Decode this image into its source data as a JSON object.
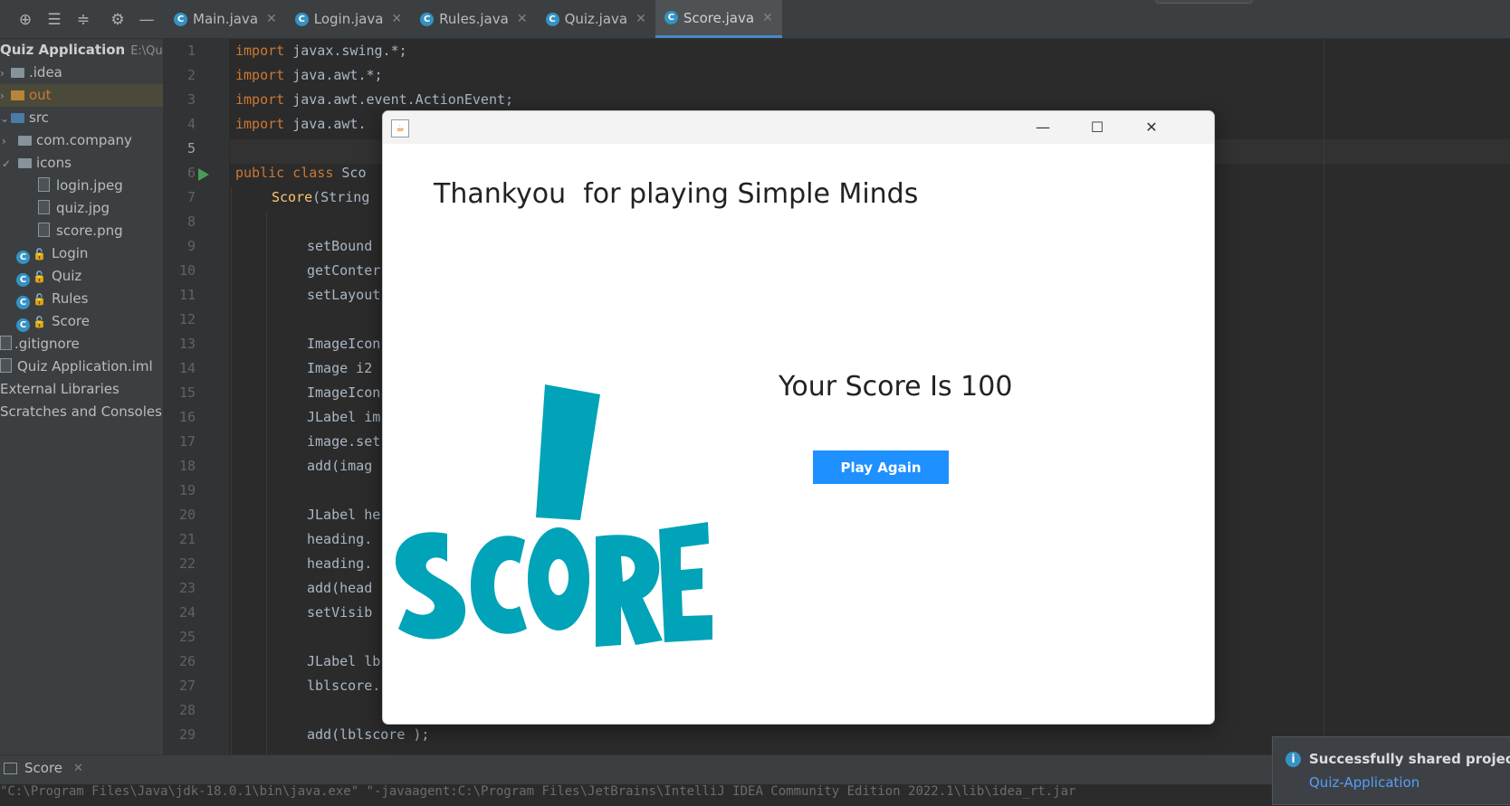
{
  "toolbar": {
    "icons": [
      "crosshair-icon",
      "expand-all-icon",
      "collapse-all-icon",
      "gear-icon",
      "minimize-icon"
    ]
  },
  "tabs": [
    {
      "label": "Main.java",
      "active": false
    },
    {
      "label": "Login.java",
      "active": false
    },
    {
      "label": "Rules.java",
      "active": false
    },
    {
      "label": "Quiz.java",
      "active": false
    },
    {
      "label": "Score.java",
      "active": true
    }
  ],
  "project": {
    "root_name": "Quiz Application",
    "root_path": "E:\\Quiz Ap",
    "items": [
      {
        "label": ".idea"
      },
      {
        "label": "out"
      },
      {
        "label": "src"
      },
      {
        "label": "com.company"
      },
      {
        "label": "icons"
      },
      {
        "label": "login.jpeg"
      },
      {
        "label": "quiz.jpg"
      },
      {
        "label": "score.png"
      },
      {
        "label": "Login"
      },
      {
        "label": "Quiz"
      },
      {
        "label": "Rules"
      },
      {
        "label": "Score"
      },
      {
        "label": ".gitignore"
      },
      {
        "label": "Quiz Application.iml"
      },
      {
        "label": "External Libraries"
      },
      {
        "label": "Scratches and Consoles"
      }
    ]
  },
  "editor": {
    "line_numbers": [
      "1",
      "2",
      "3",
      "4",
      "5",
      "6",
      "7",
      "8",
      "9",
      "10",
      "11",
      "12",
      "13",
      "14",
      "15",
      "16",
      "17",
      "18",
      "19",
      "20",
      "21",
      "22",
      "23",
      "24",
      "25",
      "26",
      "27",
      "28",
      "29"
    ],
    "lines": {
      "l1a": "import ",
      "l1b": "javax.swing.*;",
      "l2a": "import ",
      "l2b": "java.awt.*;",
      "l3a": "import ",
      "l3b": "java.awt.event.ActionEvent;",
      "l4a": "import ",
      "l4b": "java.awt.",
      "l6a": "public class ",
      "l6b": "Sco",
      "l7a": "Score",
      "l7b": "(String",
      "l9": "setBound",
      "l10": "getConter",
      "l11": "setLayout",
      "l13": "ImageIcon",
      "l14": "Image i2",
      "l15": "ImageIcon",
      "l16": "JLabel im",
      "l17": "image.set",
      "l18": "add(imag",
      "l20": "JLabel he",
      "l21": "heading.",
      "l22": "heading.",
      "l23": "add(head",
      "l24": "setVisib",
      "l26": "JLabel lb",
      "l27": "lblscore.",
      "l29": "add(lblscore );"
    }
  },
  "run": {
    "tab_label": "Score",
    "console_text": "\"C:\\Program Files\\Java\\jdk-18.0.1\\bin\\java.exe\" \"-javaagent:C:\\Program Files\\JetBrains\\IntelliJ IDEA Community Edition 2022.1\\lib\\idea_rt.jar"
  },
  "notification": {
    "title": "Successfully shared project on G",
    "link": "Quiz-Application"
  },
  "window": {
    "heading": "Thankyou  for playing Simple Minds",
    "score_text": "Your Score Is 100",
    "play_again_label": "Play Again",
    "controls": {
      "minimize": "—",
      "maximize": "☐",
      "close": "✕"
    },
    "button_color": "#1e90ff",
    "art_color": "#00a3b8"
  }
}
